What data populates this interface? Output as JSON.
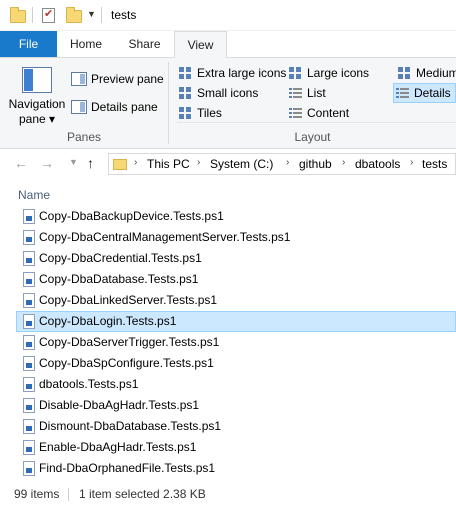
{
  "window": {
    "title": "tests"
  },
  "ribbon": {
    "tabs": {
      "file": "File",
      "home": "Home",
      "share": "Share",
      "view": "View"
    },
    "panes": {
      "navigation_pane_line1": "Navigation",
      "navigation_pane_line2": "pane ▾",
      "preview_pane": "Preview pane",
      "details_pane": "Details pane",
      "group_label": "Panes"
    },
    "layout": {
      "extra_large_icons": "Extra large icons",
      "large_icons": "Large icons",
      "medium": "Medium",
      "small_icons": "Small icons",
      "list": "List",
      "details": "Details",
      "tiles": "Tiles",
      "content": "Content",
      "group_label": "Layout",
      "selected": "Details"
    }
  },
  "address_bar": {
    "breadcrumbs": [
      "This PC",
      "System (C:)",
      "github",
      "dbatools",
      "tests"
    ]
  },
  "file_list": {
    "column_name": "Name",
    "files": [
      "Copy-DbaBackupDevice.Tests.ps1",
      "Copy-DbaCentralManagementServer.Tests.ps1",
      "Copy-DbaCredential.Tests.ps1",
      "Copy-DbaDatabase.Tests.ps1",
      "Copy-DbaLinkedServer.Tests.ps1",
      "Copy-DbaLogin.Tests.ps1",
      "Copy-DbaServerTrigger.Tests.ps1",
      "Copy-DbaSpConfigure.Tests.ps1",
      "dbatools.Tests.ps1",
      "Disable-DbaAgHadr.Tests.ps1",
      "Dismount-DbaDatabase.Tests.ps1",
      "Enable-DbaAgHadr.Tests.ps1",
      "Find-DbaOrphanedFile.Tests.ps1"
    ],
    "selected_file": "Copy-DbaLogin.Tests.ps1"
  },
  "status_bar": {
    "item_count": "99 items",
    "selection": "1 item selected  2.38 KB"
  },
  "colors": {
    "accent": "#1979ca",
    "selection_bg": "#cce8ff",
    "selection_border": "#99d1ff",
    "ribbon_bg": "#f5f6f7"
  }
}
